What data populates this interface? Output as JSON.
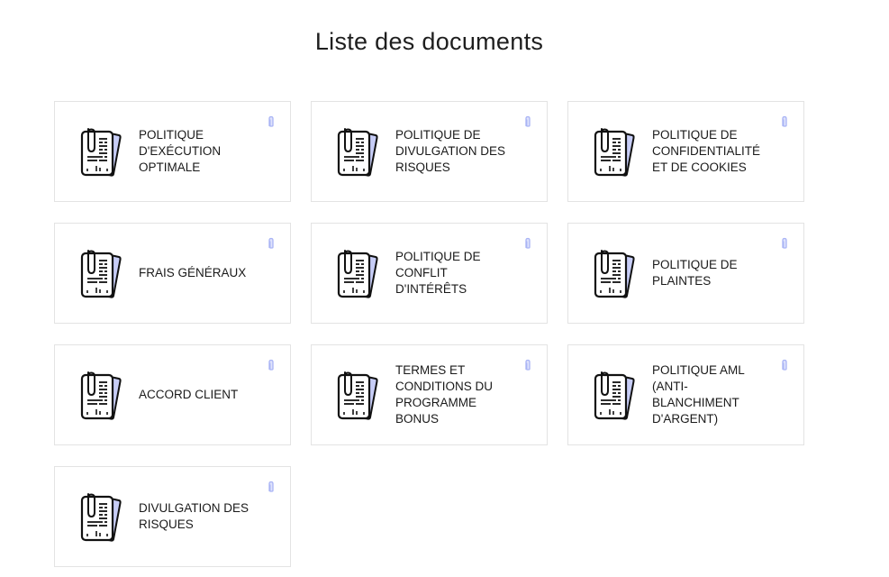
{
  "page": {
    "title": "Liste des documents"
  },
  "colors": {
    "accent": "#a9b4f5",
    "card_border": "#e3e3e3",
    "icon_stroke": "#111111",
    "icon_page_back": "#c7cdf7"
  },
  "documents": [
    {
      "label": "POLITIQUE D'EXÉCUTION OPTIMALE",
      "lines": [
        "POLITIQUE",
        "D'EXÉCUTION",
        "OPTIMALE"
      ],
      "icon": "document-icon",
      "attachment_icon": "paperclip-icon"
    },
    {
      "label": "POLITIQUE DE DIVULGATION DES RISQUES",
      "lines": [
        "POLITIQUE DE",
        "DIVULGATION DES",
        "RISQUES"
      ],
      "icon": "document-icon",
      "attachment_icon": "paperclip-icon"
    },
    {
      "label": "POLITIQUE DE CONFIDENTIALITÉ ET DE COOKIES",
      "lines": [
        "POLITIQUE DE",
        "CONFIDENTIALITÉ",
        "ET DE COOKIES"
      ],
      "icon": "document-icon",
      "attachment_icon": "paperclip-icon"
    },
    {
      "label": "FRAIS GÉNÉRAUX",
      "lines": [
        "FRAIS GÉNÉRAUX"
      ],
      "icon": "document-icon",
      "attachment_icon": "paperclip-icon"
    },
    {
      "label": "POLITIQUE DE CONFLIT D'INTÉRÊTS",
      "lines": [
        "POLITIQUE DE",
        "CONFLIT",
        "D'INTÉRÊTS"
      ],
      "icon": "document-icon",
      "attachment_icon": "paperclip-icon"
    },
    {
      "label": "POLITIQUE DE PLAINTES",
      "lines": [
        "POLITIQUE DE",
        "PLAINTES"
      ],
      "icon": "document-icon",
      "attachment_icon": "paperclip-icon"
    },
    {
      "label": "ACCORD CLIENT",
      "lines": [
        "ACCORD CLIENT"
      ],
      "icon": "document-icon",
      "attachment_icon": "paperclip-icon"
    },
    {
      "label": "TERMES ET CONDITIONS DU PROGRAMME BONUS",
      "lines": [
        "TERMES ET",
        "CONDITIONS DU",
        "PROGRAMME",
        "BONUS"
      ],
      "icon": "document-icon",
      "attachment_icon": "paperclip-icon"
    },
    {
      "label": "POLITIQUE AML (ANTI-BLANCHIMENT D'ARGENT)",
      "lines": [
        "POLITIQUE AML",
        "(ANTI-",
        "BLANCHIMENT",
        "D'ARGENT)"
      ],
      "icon": "document-icon",
      "attachment_icon": "paperclip-icon"
    },
    {
      "label": "DIVULGATION DES RISQUES",
      "lines": [
        "DIVULGATION DES",
        "RISQUES"
      ],
      "icon": "document-icon",
      "attachment_icon": "paperclip-icon"
    }
  ]
}
